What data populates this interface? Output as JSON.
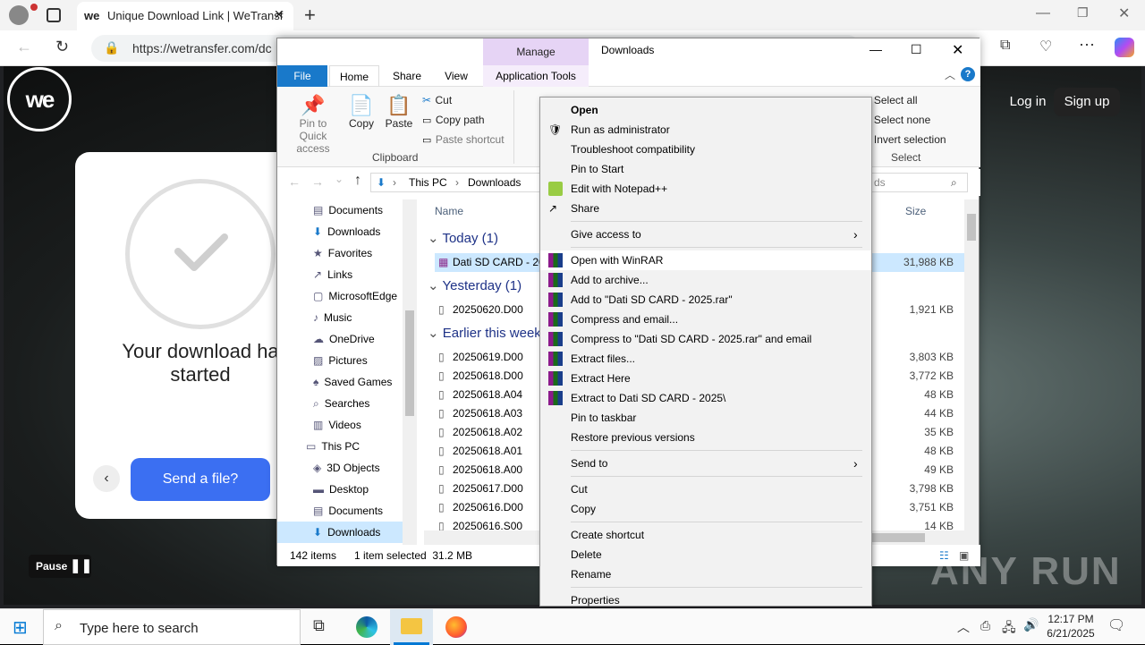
{
  "browser": {
    "tab_title": "Unique Download Link | WeTransf",
    "tab_logo": "we",
    "url": "https://wetransfer.com/dc"
  },
  "wetransfer": {
    "download_title_line1": "Your download ha",
    "download_title_line2": "started",
    "send_button": "Send a file?",
    "login": "Log in",
    "signup": "Sign up",
    "pause": "Pause"
  },
  "explorer": {
    "manage_tab": "Manage",
    "window_title": "Downloads",
    "ribbon_tabs": [
      "File",
      "Home",
      "Share",
      "View",
      "Application Tools"
    ],
    "clipboard": {
      "pin": "Pin to Quick access",
      "pin_l1": "Pin to Quick",
      "pin_l2": "access",
      "copy": "Copy",
      "paste": "Paste",
      "cut": "Cut",
      "copy_path": "Copy path",
      "paste_shortcut": "Paste shortcut",
      "group": "Clipboard"
    },
    "select": {
      "select_all": "Select all",
      "select_none": "Select none",
      "invert": "Invert selection",
      "group": "Select"
    },
    "breadcrumb": [
      "This PC",
      "Downloads"
    ],
    "search_placeholder": "ds",
    "nav_items": [
      "Documents",
      "Downloads",
      "Favorites",
      "Links",
      "MicrosoftEdge",
      "Music",
      "OneDrive",
      "Pictures",
      "Saved Games",
      "Searches",
      "Videos",
      "This PC",
      "3D Objects",
      "Desktop",
      "Documents",
      "Downloads"
    ],
    "col_name": "Name",
    "col_size": "Size",
    "groups": [
      "Today (1)",
      "Yesterday (1)",
      "Earlier this week"
    ],
    "files_today": [
      {
        "name": "Dati SD CARD - 20",
        "size": "31,988 KB"
      }
    ],
    "files_yesterday": [
      {
        "name": "20250620.D00",
        "size": "1,921 KB"
      }
    ],
    "files_week": [
      {
        "name": "20250619.D00",
        "size": "3,803 KB"
      },
      {
        "name": "20250618.D00",
        "size": "3,772 KB"
      },
      {
        "name": "20250618.A04",
        "size": "48 KB"
      },
      {
        "name": "20250618.A03",
        "size": "44 KB"
      },
      {
        "name": "20250618.A02",
        "size": "35 KB"
      },
      {
        "name": "20250618.A01",
        "size": "48 KB"
      },
      {
        "name": "20250618.A00",
        "size": "49 KB"
      },
      {
        "name": "20250617.D00",
        "size": "3,798 KB"
      },
      {
        "name": "20250616.D00",
        "size": "3,751 KB"
      },
      {
        "name": "20250616.S00",
        "size": "14 KB"
      }
    ],
    "status_items": "142 items",
    "status_selected": "1 item selected  31.2 MB"
  },
  "context_menu": {
    "items": [
      "Open",
      "Run as administrator",
      "Troubleshoot compatibility",
      "Pin to Start",
      "Edit with Notepad++",
      "Share",
      "Give access to",
      "Open with WinRAR",
      "Add to archive...",
      "Add to \"Dati SD CARD - 2025.rar\"",
      "Compress and email...",
      "Compress to \"Dati SD CARD - 2025.rar\" and email",
      "Extract files...",
      "Extract Here",
      "Extract to Dati SD CARD - 2025\\",
      "Pin to taskbar",
      "Restore previous versions",
      "Send to",
      "Cut",
      "Copy",
      "Create shortcut",
      "Delete",
      "Rename",
      "Properties"
    ]
  },
  "taskbar": {
    "search_placeholder": "Type here to search",
    "time": "12:17 PM",
    "date": "6/21/2025"
  },
  "watermark": "ANY RUN",
  "colors": {
    "wetransfer_blue": "#3b6ff2",
    "explorer_accent": "#1979ca",
    "manage_tab": "#e6d4f5",
    "selected_row": "#cce8ff"
  }
}
